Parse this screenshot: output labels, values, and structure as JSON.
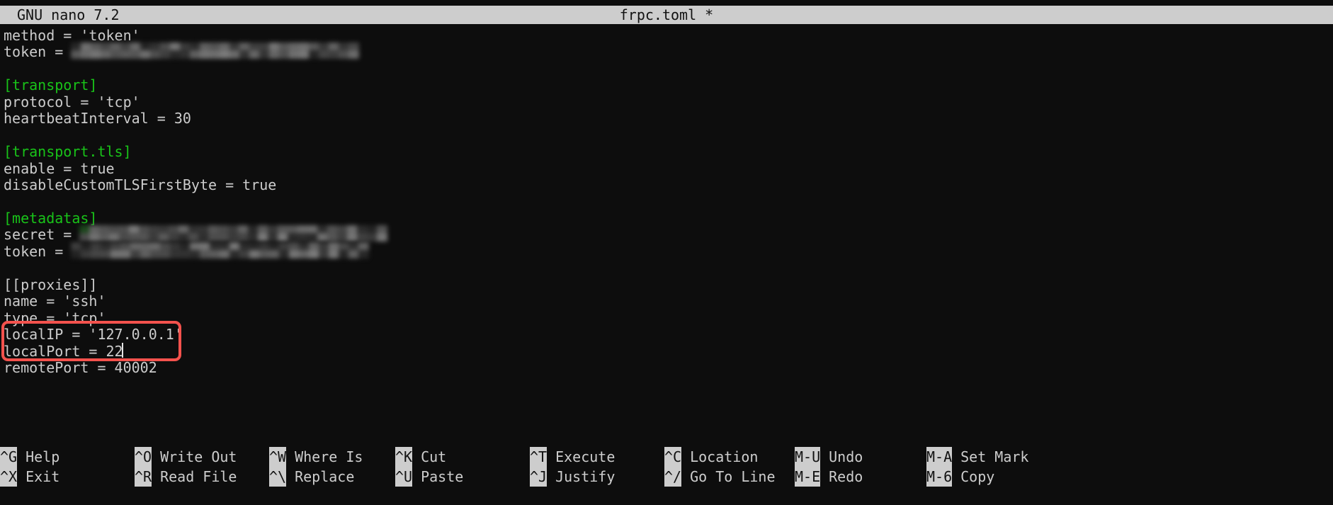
{
  "titlebar": {
    "app_name": "GNU nano 7.2",
    "filename": "frpc.toml *"
  },
  "editor": {
    "colors": {
      "background": "#0d0d0d",
      "foreground": "#cccccc",
      "section_header": "#19c319",
      "annotation_red": "#f4524d",
      "titlebar_background": "#cdcdcd",
      "titlebar_foreground": "#121212"
    },
    "lines": [
      {
        "text": "method = 'token'",
        "kind": "plain"
      },
      {
        "text": "token = ",
        "kind": "plain",
        "redacted": true
      },
      {
        "text": "",
        "kind": "plain"
      },
      {
        "text": "[transport]",
        "kind": "section"
      },
      {
        "text": "protocol = 'tcp'",
        "kind": "plain"
      },
      {
        "text": "heartbeatInterval = 30",
        "kind": "plain"
      },
      {
        "text": "",
        "kind": "plain"
      },
      {
        "text": "[transport.tls]",
        "kind": "section"
      },
      {
        "text": "enable = true",
        "kind": "plain"
      },
      {
        "text": "disableCustomTLSFirstByte = true",
        "kind": "plain"
      },
      {
        "text": "",
        "kind": "plain"
      },
      {
        "text": "[metadatas]",
        "kind": "section"
      },
      {
        "text": "secret = ",
        "kind": "plain",
        "redacted": true
      },
      {
        "text": "token = ",
        "kind": "plain",
        "redacted": true
      },
      {
        "text": "",
        "kind": "plain"
      },
      {
        "text": "[[proxies]]",
        "kind": "plain"
      },
      {
        "text": "name = 'ssh'",
        "kind": "plain"
      },
      {
        "text": "type = 'tcp'",
        "kind": "plain"
      },
      {
        "text": "localIP = '127.0.0.1'",
        "kind": "plain",
        "highlighted": true
      },
      {
        "text": "localPort = 22",
        "kind": "plain",
        "highlighted": true
      },
      {
        "text": "remotePort = 40002",
        "kind": "plain"
      }
    ]
  },
  "annotation": {
    "color": "#f4524d",
    "targets": [
      "localIP = '127.0.0.1'",
      "localPort = 22"
    ]
  },
  "cursor": {
    "line": "localPort = 22",
    "after_text": "22"
  },
  "shortcuts": [
    {
      "key": "^G",
      "label": "Help",
      "col": 0,
      "row": 0
    },
    {
      "key": "^X",
      "label": "Exit",
      "col": 0,
      "row": 1
    },
    {
      "key": "^O",
      "label": "Write Out",
      "col": 1,
      "row": 0
    },
    {
      "key": "^R",
      "label": "Read File",
      "col": 1,
      "row": 1
    },
    {
      "key": "^W",
      "label": "Where Is",
      "col": 2,
      "row": 0
    },
    {
      "key": "^\\",
      "label": "Replace",
      "col": 2,
      "row": 1
    },
    {
      "key": "^K",
      "label": "Cut",
      "col": 3,
      "row": 0
    },
    {
      "key": "^U",
      "label": "Paste",
      "col": 3,
      "row": 1
    },
    {
      "key": "^T",
      "label": "Execute",
      "col": 4,
      "row": 0
    },
    {
      "key": "^J",
      "label": "Justify",
      "col": 4,
      "row": 1
    },
    {
      "key": "^C",
      "label": "Location",
      "col": 5,
      "row": 0
    },
    {
      "key": "^/",
      "label": "Go To Line",
      "col": 5,
      "row": 1
    },
    {
      "key": "M-U",
      "label": "Undo",
      "col": 6,
      "row": 0
    },
    {
      "key": "M-E",
      "label": "Redo",
      "col": 6,
      "row": 1
    },
    {
      "key": "M-A",
      "label": "Set Mark",
      "col": 7,
      "row": 0
    },
    {
      "key": "M-6",
      "label": "Copy",
      "col": 7,
      "row": 1
    }
  ]
}
